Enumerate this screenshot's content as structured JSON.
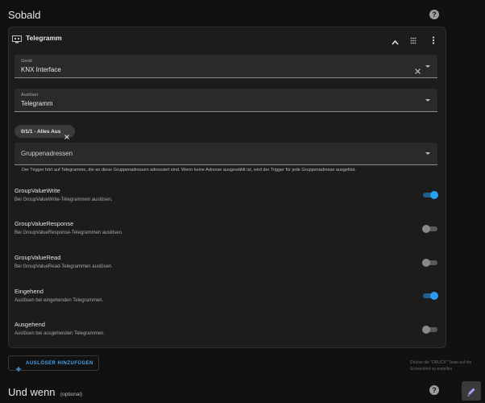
{
  "section_when": {
    "title": "Sobald"
  },
  "card": {
    "title": "Telegramm"
  },
  "device_field": {
    "label": "Gerät",
    "value": "KNX Interface"
  },
  "trigger_field": {
    "label": "Auslöser",
    "value": "Telegramm"
  },
  "chip": {
    "label": "0/1/1 - Alles Aus"
  },
  "group_field": {
    "placeholder": "Gruppenadressen"
  },
  "helper_text": "Der Trigger hört auf Telegramme, die an diese Gruppenadressen adressiert sind. Wenn keine Adresse ausgewählt ist, wird der Trigger für jede Gruppenadresse ausgelöst.",
  "options": [
    {
      "title": "GroupValueWrite",
      "desc": "Bei GroupValueWrite-Telegrammen auslösen.",
      "enabled": true
    },
    {
      "title": "GroupValueResponse",
      "desc": "Bei GroupValueResponse-Telegrammen auslösen.",
      "enabled": false
    },
    {
      "title": "GroupValueRead",
      "desc": "Bei GroupValueRead-Telegrammen auslösen.",
      "enabled": false
    },
    {
      "title": "Eingehend",
      "desc": "Auslösen bei eingehenden Telegrammen.",
      "enabled": true
    },
    {
      "title": "Ausgehend",
      "desc": "Auslösen bei ausgehenden Telegrammen.",
      "enabled": false
    }
  ],
  "add_trigger_button": "AUSLÖSER HINZUFÜGEN",
  "section_if": {
    "title": "Und wenn",
    "optional": "(optional)"
  },
  "tooltip": {
    "line1": "Drücke die \"DRUCK\" Taste auf dei",
    "line2": "Screenshot zu erstellen"
  },
  "colors": {
    "accent": "#2a9cf0",
    "background": "#111111",
    "card": "#1c1c1c"
  }
}
